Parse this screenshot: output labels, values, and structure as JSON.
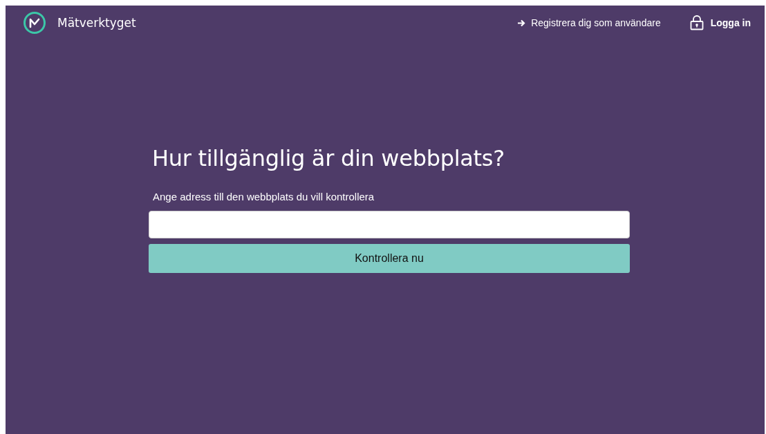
{
  "header": {
    "brand": "Mätverktyget",
    "links": [
      {
        "kind": "register",
        "label": "Registrera dig som användare"
      },
      {
        "kind": "login",
        "label": "Logga in"
      }
    ]
  },
  "main": {
    "heading": "Hur tillgänglig är din webbplats?",
    "field_label": "Ange adress till den webbplats du vill kontrollera",
    "button": "Kontrollera nu"
  }
}
